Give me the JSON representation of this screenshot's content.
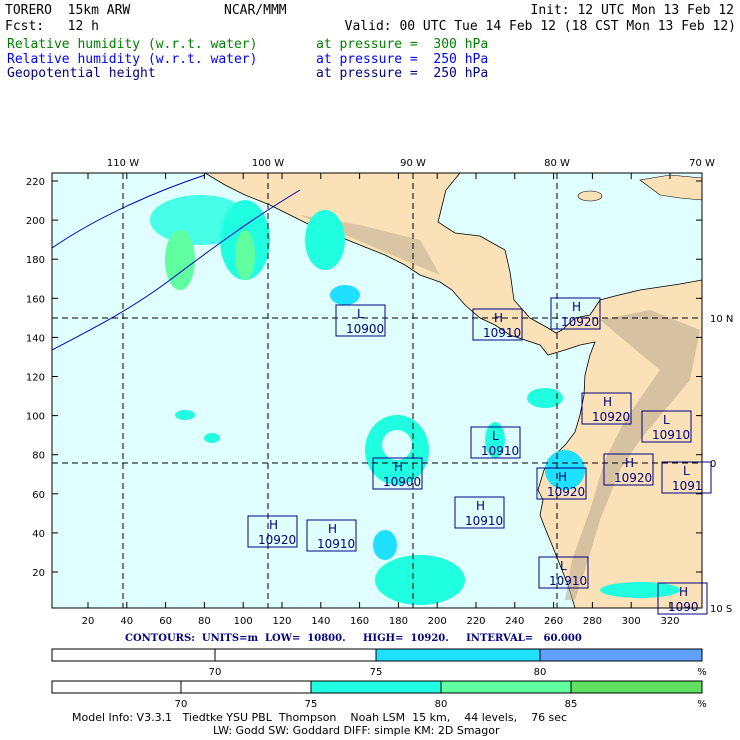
{
  "header": {
    "model": "TORERO  15km ARW",
    "org": "NCAR/MMM",
    "init": "Init: 12 UTC Mon 13 Feb 12",
    "fcst": "Fcst:   12 h",
    "valid": "Valid: 00 UTC Tue 14 Feb 12 (18 CST Mon 13 Feb 12)"
  },
  "fields": [
    {
      "name": "Relative humidity (w.r.t. water)",
      "level": "at pressure =  300 hPa",
      "color": "#008000"
    },
    {
      "name": "Relative humidity (w.r.t. water)",
      "level": "at pressure =  250 hPa",
      "color": "#0000ff"
    },
    {
      "name": "Geopotential height",
      "level": "at pressure =  250 hPa",
      "color": "#000080"
    }
  ],
  "axes": {
    "lon_labels": [
      "110 W",
      "100 W",
      "90 W",
      "80 W",
      "70 W"
    ],
    "lat_labels": [
      "10 N",
      "0",
      "10 S"
    ],
    "y_ticks": [
      "20",
      "40",
      "60",
      "80",
      "100",
      "120",
      "140",
      "160",
      "180",
      "200",
      "220"
    ],
    "x_ticks": [
      "20",
      "40",
      "60",
      "80",
      "100",
      "120",
      "140",
      "160",
      "180",
      "200",
      "220",
      "240",
      "260",
      "280",
      "300",
      "320"
    ]
  },
  "centers": [
    {
      "t": "L",
      "v": "10900"
    },
    {
      "t": "H",
      "v": "10910"
    },
    {
      "t": "H",
      "v": "10920"
    },
    {
      "t": "H",
      "v": "10920"
    },
    {
      "t": "L",
      "v": "10910"
    },
    {
      "t": "L",
      "v": "10910"
    },
    {
      "t": "H",
      "v": "10900"
    },
    {
      "t": "H",
      "v": "10920"
    },
    {
      "t": "H",
      "v": "10920"
    },
    {
      "t": "L",
      "v": "1091"
    },
    {
      "t": "H",
      "v": "10910"
    },
    {
      "t": "H",
      "v": "10910"
    },
    {
      "t": "H",
      "v": "10920"
    },
    {
      "t": "L",
      "v": "10910"
    },
    {
      "t": "H",
      "v": "1090"
    }
  ],
  "contours": "CONTOURS:  UNITS=m  LOW=  10800.     HIGH=  10920.     INTERVAL=   60.000",
  "bar1": {
    "labels": [
      "70",
      "75",
      "80",
      "%"
    ],
    "colors": [
      "#ffffff",
      "#ffffff",
      "#20e0ff",
      "#60a0ff"
    ]
  },
  "bar2": {
    "labels": [
      "70",
      "75",
      "80",
      "85",
      "%"
    ],
    "colors": [
      "#ffffff",
      "#ffffff",
      "#20ffe0",
      "#60ff9f",
      "#60e060"
    ]
  },
  "model_info": {
    "line1": "Model Info: V3.3.1   Tiedtke YSU PBL  Thompson    Noah LSM  15 km,    44 levels,    76 sec",
    "line2": "LW: Godd SW: Goddard DIFF: simple KM: 2D Smagor"
  }
}
